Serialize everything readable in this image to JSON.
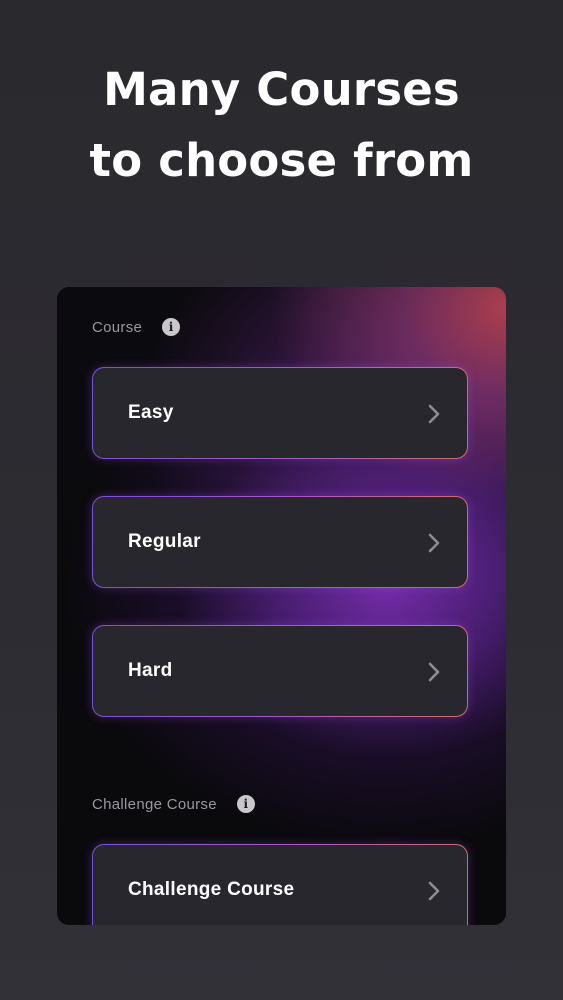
{
  "headline": {
    "line1": "Many Courses",
    "line2": "to choose from"
  },
  "panel": {
    "course_section": {
      "label": "Course",
      "info_icon": "info-icon",
      "items": [
        {
          "label": "Easy",
          "icon": "chevron-right-icon"
        },
        {
          "label": "Regular",
          "icon": "chevron-right-icon"
        },
        {
          "label": "Hard",
          "icon": "chevron-right-icon"
        }
      ]
    },
    "challenge_section": {
      "label": "Challenge Course",
      "info_icon": "info-icon",
      "items": [
        {
          "label": "Challenge Course",
          "icon": "chevron-right-icon"
        }
      ]
    }
  },
  "colors": {
    "background": "#2b2a30",
    "panel": "#0b0a0e",
    "button": "#28272d",
    "border_start": "#7a4fd8",
    "border_end": "#d06a6a",
    "glow_purple": "#782daf",
    "glow_red": "#c44650",
    "label_gray": "#9a97a0",
    "text": "#ffffff"
  }
}
